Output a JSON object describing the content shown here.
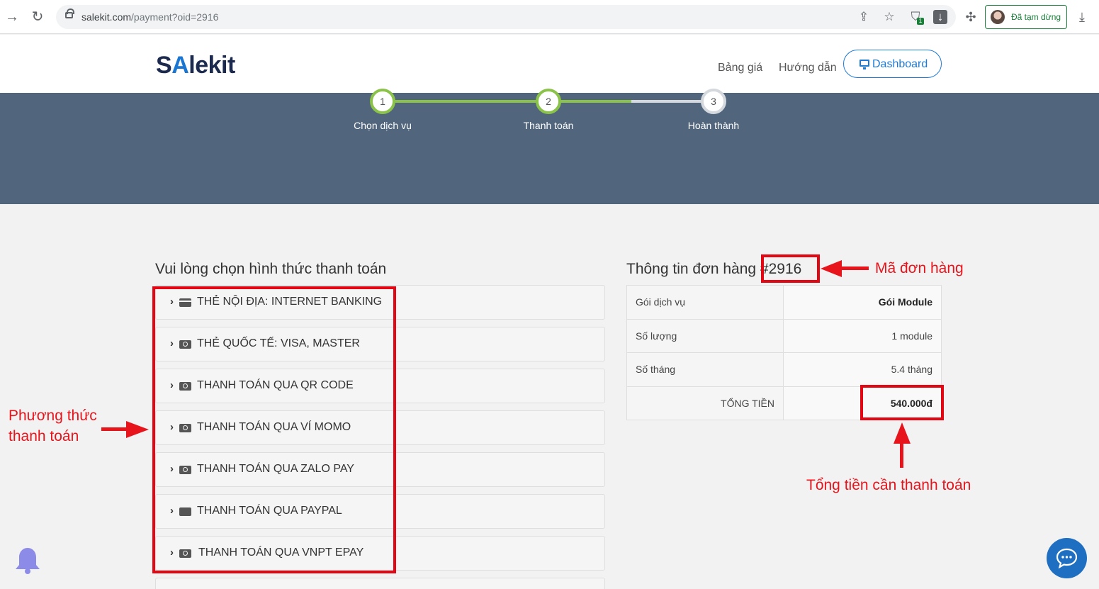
{
  "browser": {
    "url_host": "salekit.com",
    "url_path": "/payment?oid=2916",
    "profile_status": "Đã tạm dừng",
    "extension_badge": "1"
  },
  "header": {
    "logo_a": "S",
    "logo_b": "A",
    "logo_c": "lekit",
    "nav": [
      "Bảng giá",
      "Hướng dẫn"
    ],
    "dashboard_label": "Dashboard"
  },
  "steps": [
    {
      "num": "1",
      "label": "Chọn dịch vụ"
    },
    {
      "num": "2",
      "label": "Thanh toán"
    },
    {
      "num": "3",
      "label": "Hoàn thành"
    }
  ],
  "payment": {
    "title": "Vui lòng chọn hình thức thanh toán",
    "methods": [
      "THẺ NỘI ĐỊA: INTERNET BANKING",
      "THẺ QUỐC TẾ: VISA, MASTER",
      "THANH TOÁN QUA QR CODE",
      "THANH TOÁN QUA VÍ MOMO",
      "THANH TOÁN QUA ZALO PAY",
      "THANH TOÁN QUA PAYPAL",
      "THANH TOÁN QUA VNPT EPAY"
    ]
  },
  "order": {
    "title_prefix": "Thông tin đơn hàng",
    "order_id": "#2916",
    "rows": [
      {
        "key": "Gói dịch vụ",
        "value": "Gói Module"
      },
      {
        "key": "Số lượng",
        "value": "1 module"
      },
      {
        "key": "Số tháng",
        "value": "5.4 tháng"
      }
    ],
    "total_label": "TỔNG TIỀN",
    "total_value": "540.000đ"
  },
  "annotations": {
    "order_code": "Mã đơn hàng",
    "payment_method_line1": "Phương thức",
    "payment_method_line2": "thanh toán",
    "total_to_pay": "Tổng tiền cần thanh toán"
  },
  "colors": {
    "hero_bg": "#51657c",
    "step_done": "#8bc34a",
    "accent": "#1e7ad6",
    "annotation_red": "#e30613"
  }
}
